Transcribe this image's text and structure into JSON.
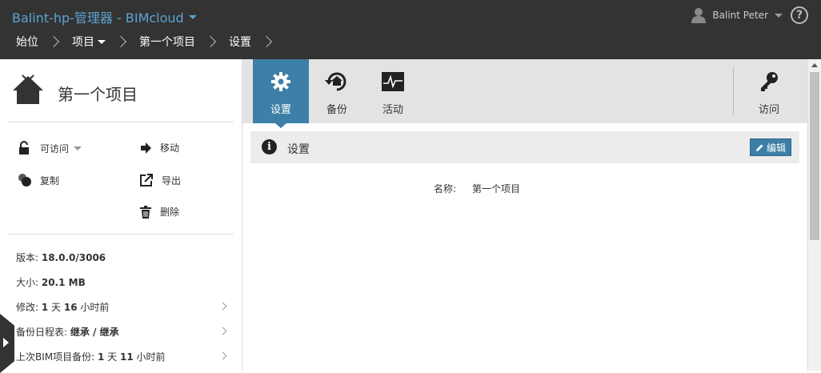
{
  "header": {
    "app_title": "Balint-hp-管理器 - BIMcloud",
    "breadcrumbs": [
      "始位",
      "项目",
      "第一个项目",
      "设置"
    ],
    "user_name": "Balint Peter",
    "help_label": "?"
  },
  "project": {
    "title": "第一个项目",
    "actions": {
      "access": "可访问",
      "move": "移动",
      "copy": "复制",
      "export": "导出",
      "delete": "删除"
    },
    "info": {
      "version_label": "版本: ",
      "version_value": "18.0.0/3006",
      "size_label": "大小: ",
      "size_value": "20.1 MB",
      "modified_label": "修改: ",
      "modified_value_a": "1",
      "modified_text_a": " 天 ",
      "modified_value_b": "16",
      "modified_text_b": " 小时前",
      "backup_schedule_label": "备份日程表: ",
      "backup_schedule_value": "继承 / 继承",
      "last_backup_label": "上次BIM项目备份: ",
      "last_backup_value_a": "1",
      "last_backup_text_a": " 天 ",
      "last_backup_value_b": "11",
      "last_backup_text_b": " 小时前"
    }
  },
  "toolbar": {
    "settings": "设置",
    "backup": "备份",
    "activity": "活动",
    "access": "访问"
  },
  "settings_section": {
    "title": "设置",
    "edit_label": "编辑",
    "name_label": "名称:",
    "name_value": "第一个项目"
  },
  "colors": {
    "topbar": "#333333",
    "accent": "#3d7fa6",
    "title_link": "#5ba3d1"
  }
}
